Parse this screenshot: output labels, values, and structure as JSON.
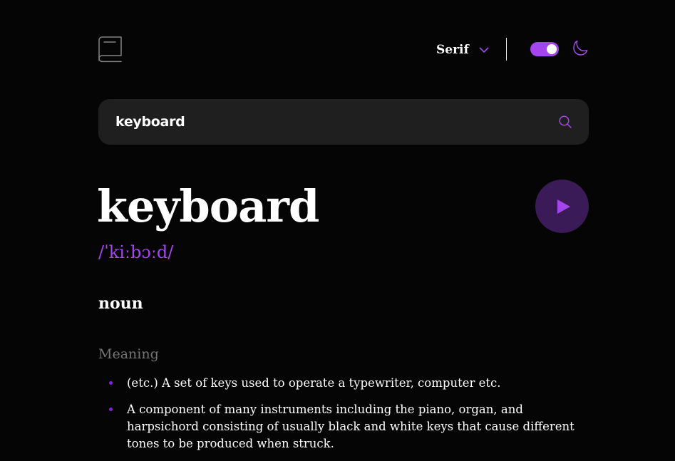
{
  "header": {
    "font_select": {
      "label": "Serif"
    },
    "theme": {
      "dark_mode": true
    }
  },
  "search": {
    "value": "keyboard",
    "placeholder": ""
  },
  "entry": {
    "word": "keyboard",
    "phonetic": "/ˈkiːbɔːd/",
    "part_of_speech": "noun",
    "meaning_heading": "Meaning",
    "definitions": [
      "(etc.) A set of keys used to operate a typewriter, computer etc.",
      "A component of many instruments including the piano, organ, and harpsichord consisting of usually black and white keys that cause different tones to be produced when struck."
    ]
  },
  "colors": {
    "accent": "#a445ed",
    "background": "#050505",
    "surface": "#1f1f1f",
    "muted_text": "#757575",
    "play_background": "#3a1b57"
  },
  "icons": {
    "logo": "book-icon",
    "font_dropdown": "chevron-down-icon",
    "theme": "moon-icon",
    "search": "search-icon",
    "play": "play-icon"
  }
}
